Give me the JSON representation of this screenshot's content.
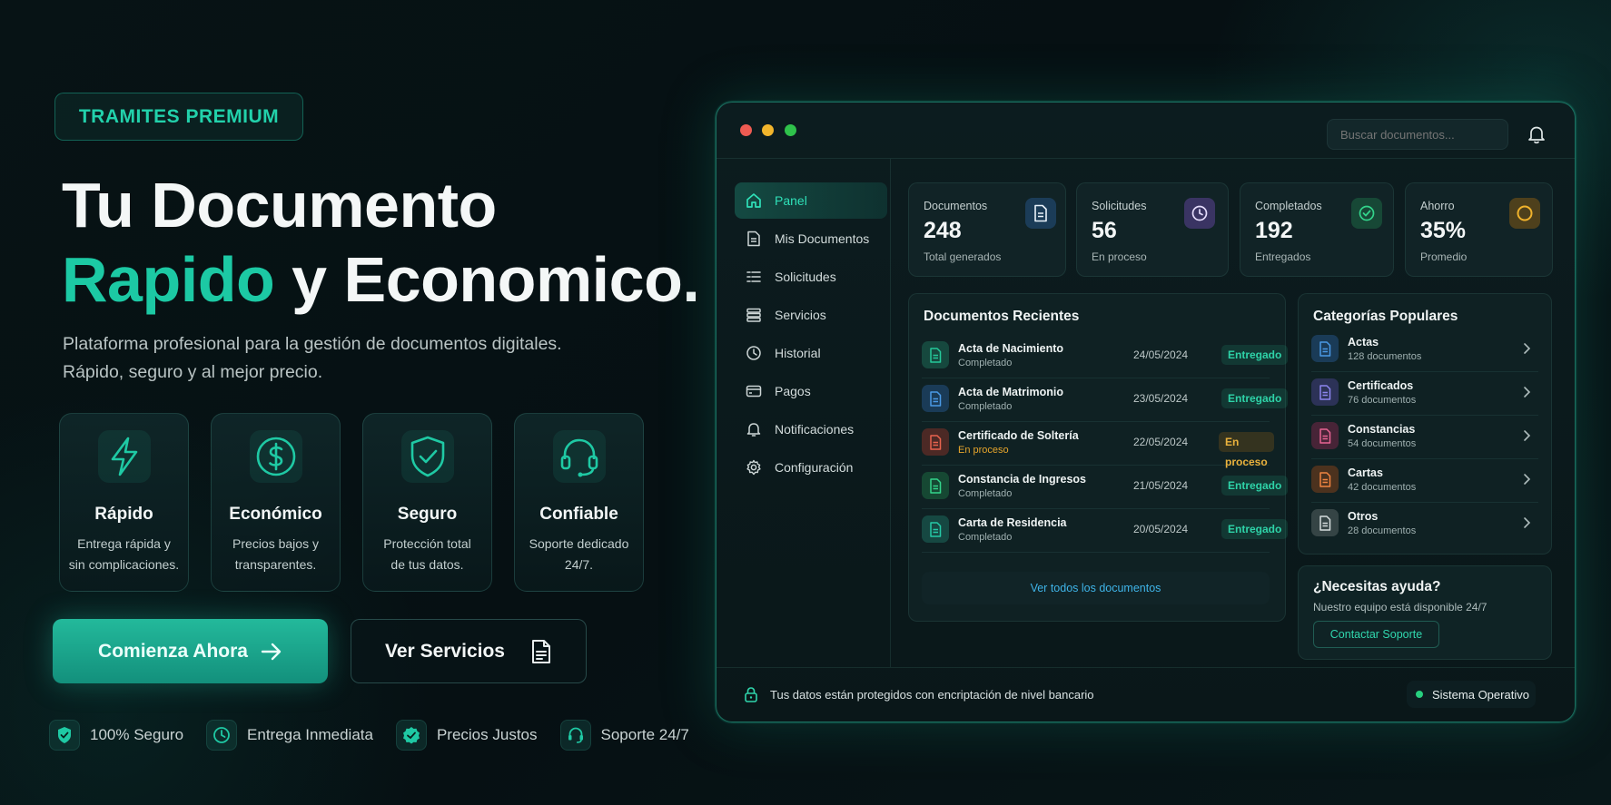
{
  "hero": {
    "badge": "TRAMITES PREMIUM",
    "title_line1": "Tu Documento",
    "title_accent": "Rapido",
    "title_rest": " y Economico.",
    "subtitle_line1": "Plataforma profesional para la gestión de documentos digitales.",
    "subtitle_line2": "Rápido, seguro y al mejor precio.",
    "features": [
      {
        "icon": "lightning-icon",
        "title": "Rápido",
        "line1": "Entrega rápida y",
        "line2": "sin complicaciones."
      },
      {
        "icon": "dollar-icon",
        "title": "Económico",
        "line1": "Precios bajos y",
        "line2": "transparentes."
      },
      {
        "icon": "shield-check-icon",
        "title": "Seguro",
        "line1": "Protección total",
        "line2": "de tus datos."
      },
      {
        "icon": "headset-icon",
        "title": "Confiable",
        "line1": "Soporte dedicado",
        "line2": "24/7."
      }
    ],
    "cta_primary": "Comienza Ahora",
    "cta_secondary": "Ver Servicios",
    "trust": [
      "100% Seguro",
      "Entrega Inmediata",
      "Precios Justos",
      "Soporte 24/7"
    ]
  },
  "app": {
    "search_placeholder": "Buscar documentos...",
    "nav": [
      "Panel",
      "Mis Documentos",
      "Solicitudes",
      "Servicios",
      "Historial",
      "Pagos",
      "Notificaciones",
      "Configuración"
    ],
    "stats": [
      {
        "label": "Documentos",
        "value": "248",
        "sub": "Total generados",
        "color": "#3b8fe0"
      },
      {
        "label": "Solicitudes",
        "value": "56",
        "sub": "En proceso",
        "color": "#9a72e8"
      },
      {
        "label": "Completados",
        "value": "192",
        "sub": "Entregados",
        "color": "#28c987"
      },
      {
        "label": "Ahorro",
        "value": "35%",
        "sub": "Promedio",
        "color": "#e8a62a"
      }
    ],
    "recent_title": "Documentos Recientes",
    "recent": [
      {
        "name": "Acta de Nacimiento",
        "state": "Completado",
        "date": "24/05/2024",
        "status": "Entregado",
        "color": "#25c99a"
      },
      {
        "name": "Acta de Matrimonio",
        "state": "Completado",
        "date": "23/05/2024",
        "status": "Entregado",
        "color": "#3b8fe0"
      },
      {
        "name": "Certificado de Soltería",
        "state": "En proceso",
        "date": "22/05/2024",
        "status": "En proceso",
        "color": "#e0533f"
      },
      {
        "name": "Constancia de Ingresos",
        "state": "Completado",
        "date": "21/05/2024",
        "status": "Entregado",
        "color": "#28c987"
      },
      {
        "name": "Carta de Residencia",
        "state": "Completado",
        "date": "20/05/2024",
        "status": "Entregado",
        "color": "#25c9a6"
      }
    ],
    "view_all": "Ver todos los documentos",
    "categories_title": "Categorías Populares",
    "categories": [
      {
        "name": "Actas",
        "count": "128 documentos",
        "color": "#3b8fe0"
      },
      {
        "name": "Certificados",
        "count": "76 documentos",
        "color": "#7e78e6"
      },
      {
        "name": "Constancias",
        "count": "54 documentos",
        "color": "#e05a8a"
      },
      {
        "name": "Cartas",
        "count": "42 documentos",
        "color": "#ee7a33"
      },
      {
        "name": "Otros",
        "count": "28 documentos",
        "color": "#c9d2d2"
      }
    ],
    "help_title": "¿Necesitas ayuda?",
    "help_desc": "Nuestro equipo está disponible 24/7",
    "help_button": "Contactar Soporte",
    "footer_text": "Tus datos están protegidos con encriptación de nivel bancario",
    "system_status": "Sistema Operativo"
  },
  "colors": {
    "accent": "#1cc9a4",
    "background": "#071315"
  }
}
